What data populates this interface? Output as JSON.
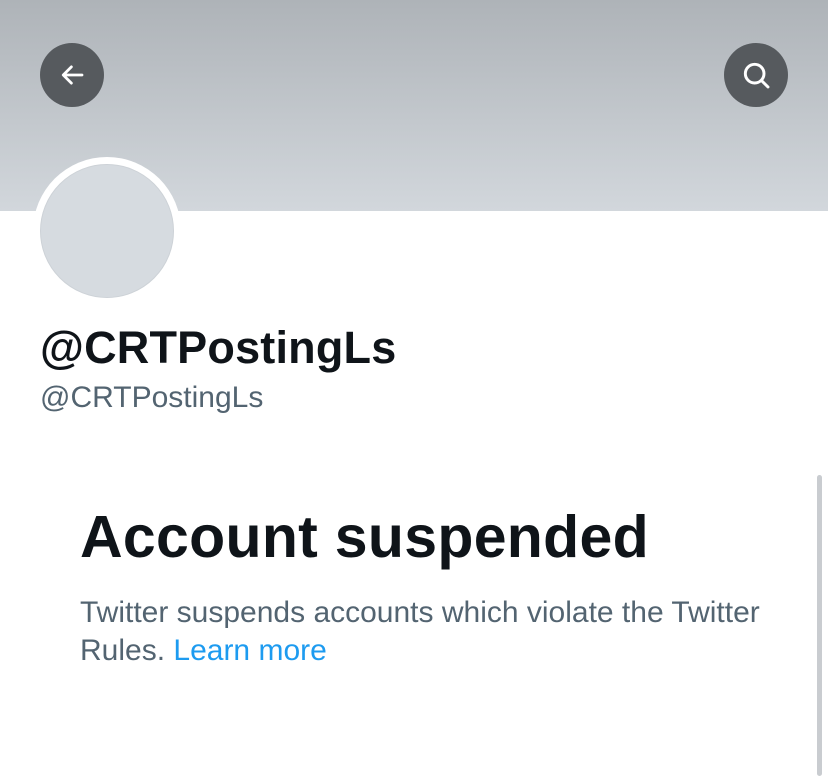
{
  "profile": {
    "display_name": "@CRTPostingLs",
    "handle": "@CRTPostingLs"
  },
  "header": {
    "back_icon": "arrow-left-icon",
    "search_icon": "search-icon"
  },
  "notice": {
    "title": "Account suspended",
    "description": "Twitter suspends accounts which violate the Twitter Rules.",
    "link_label": "Learn more"
  },
  "colors": {
    "primary_text": "#0f1419",
    "secondary_text": "#536471",
    "link": "#1d9bf0",
    "icon_button_bg": "#565a5e"
  }
}
